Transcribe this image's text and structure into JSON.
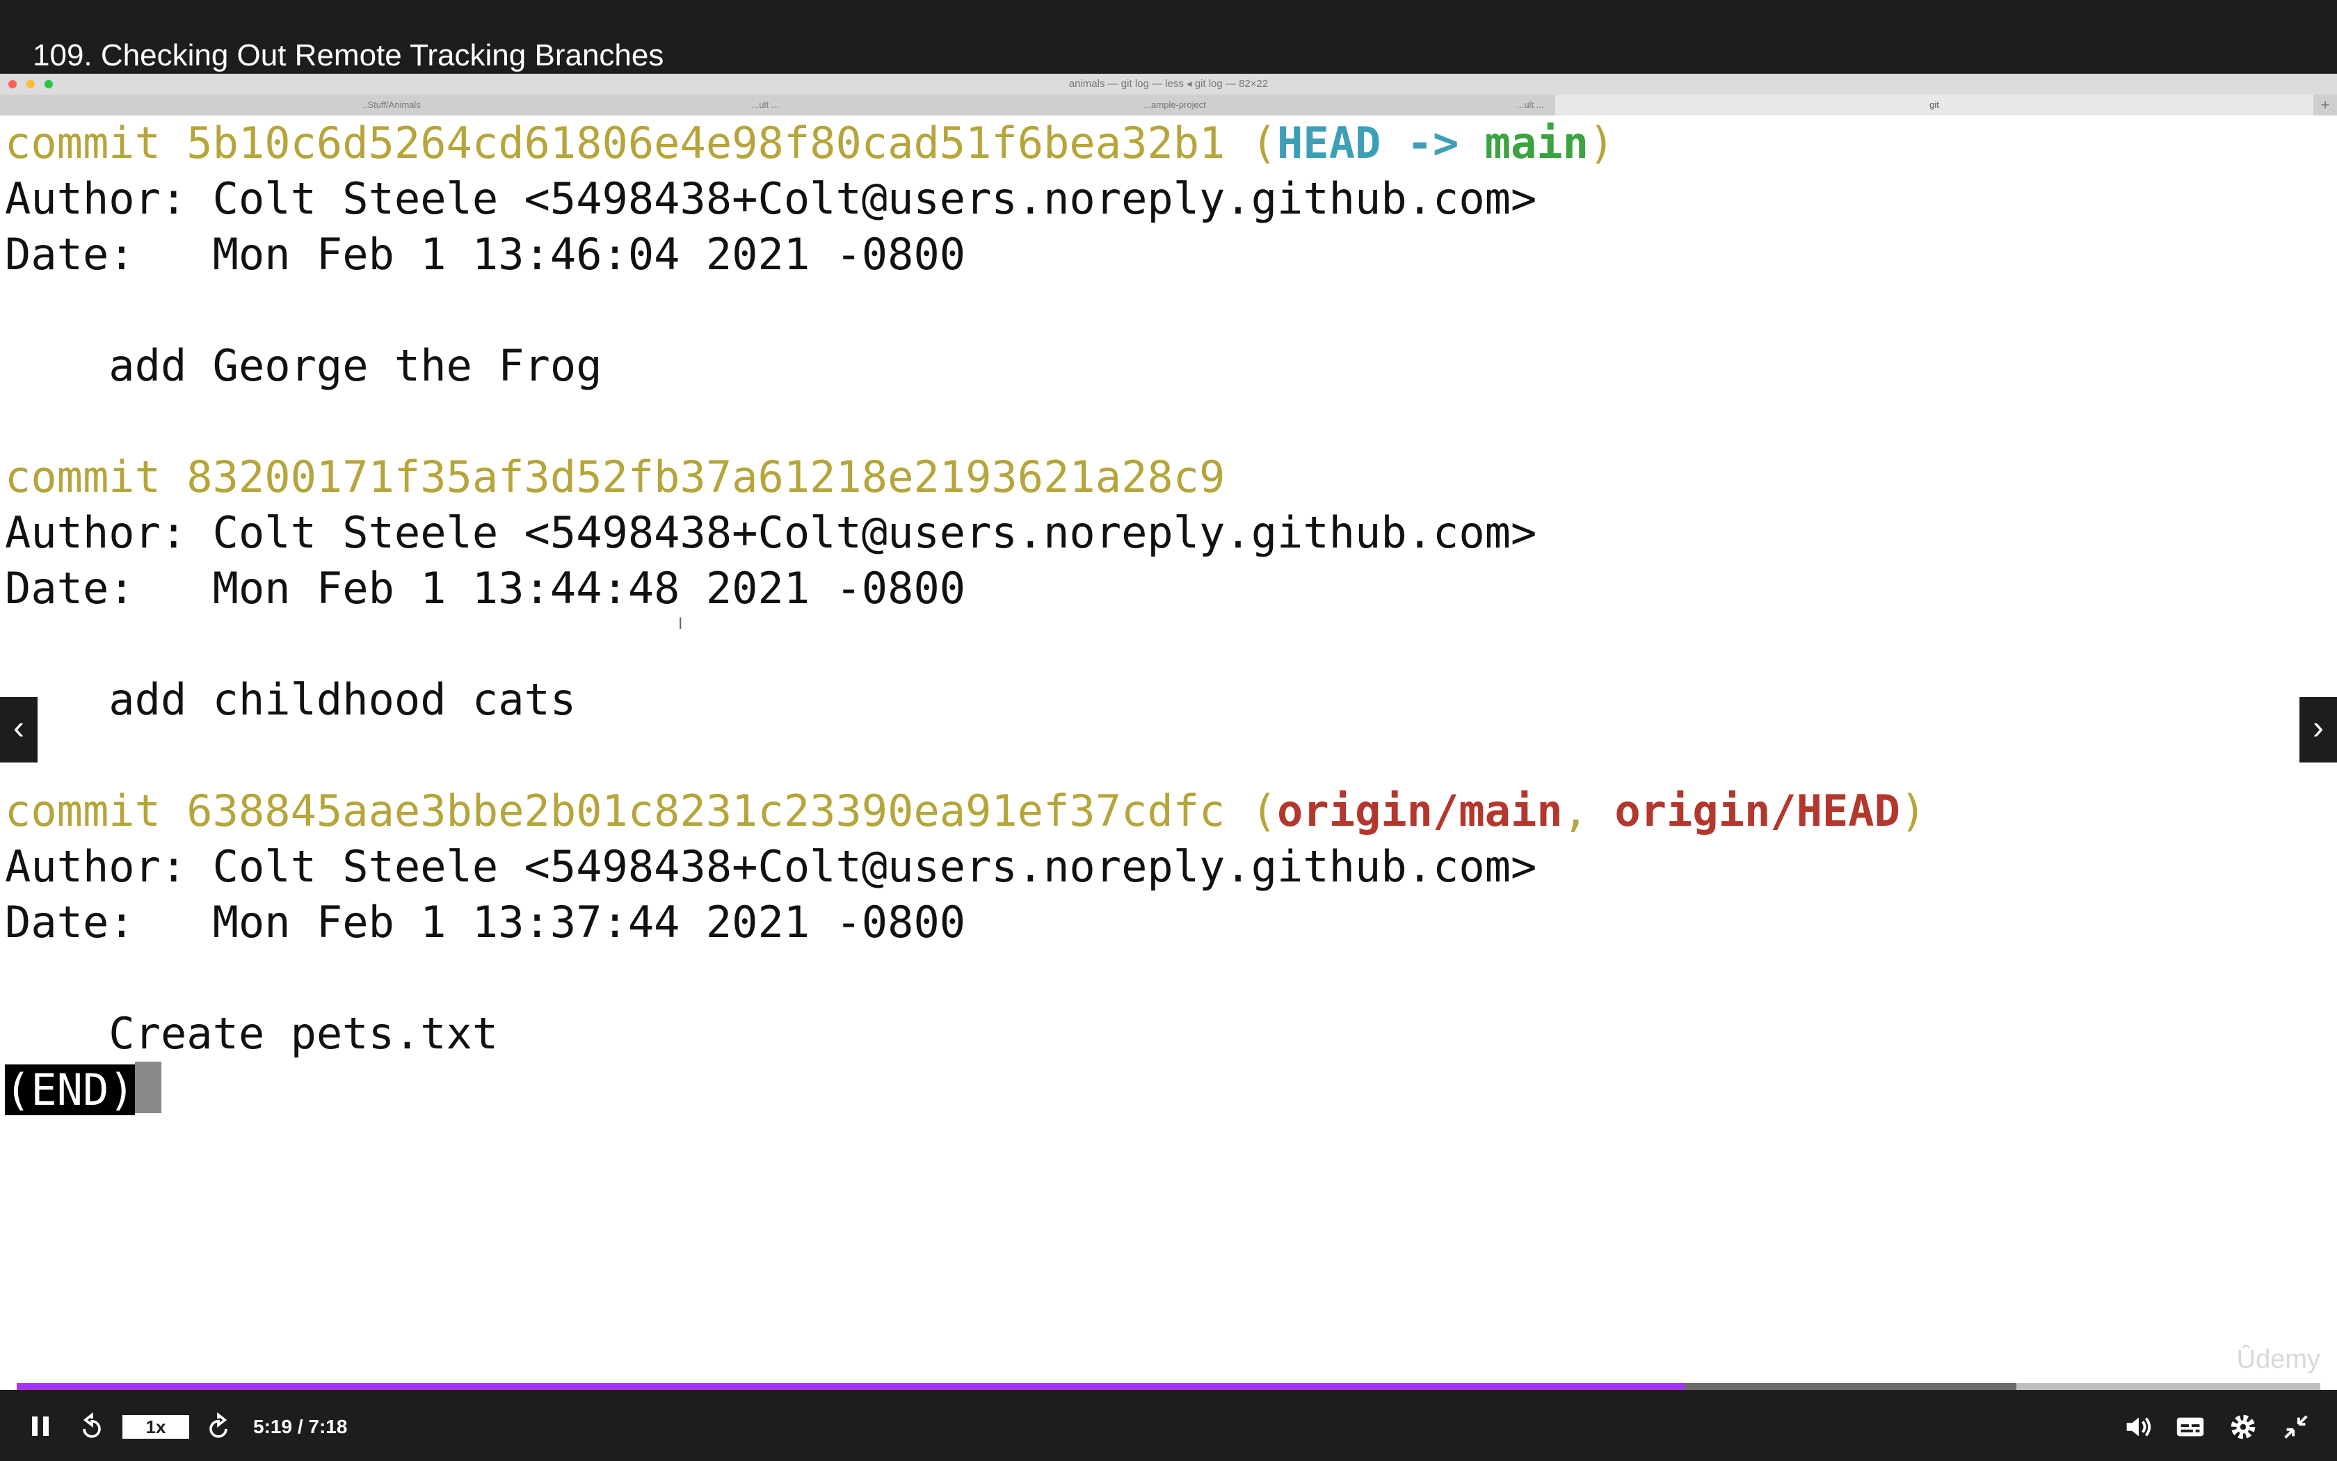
{
  "lecture": {
    "title": "109. Checking Out Remote Tracking Branches"
  },
  "terminal_window": {
    "title": "animals — git log — less ◂ git log — 82×22",
    "tabs": [
      "..Stuff/Animals",
      "...ult ...",
      "...ample-project",
      "...ult ...",
      "git"
    ]
  },
  "terminal": {
    "commits": [
      {
        "hash_line": "commit 5b10c6d5264cd61806e4e98f80cad51f6bea32b1",
        "refs_open": " (",
        "ref1": "HEAD -> ",
        "ref2": "main",
        "refs_close": ")",
        "author": "Author: Colt Steele <5498438+Colt@users.noreply.github.com>",
        "date": "Date:   Mon Feb 1 13:46:04 2021 -0800",
        "message": "    add George the Frog"
      },
      {
        "hash_line": "commit 83200171f35af3d52fb37a61218e2193621a28c9",
        "author": "Author: Colt Steele <5498438+Colt@users.noreply.github.com>",
        "date": "Date:   Mon Feb 1 13:44:48 2021 -0800",
        "message": "    add childhood cats"
      },
      {
        "hash_line": "commit 638845aae3bbe2b01c8231c23390ea91ef37cdfc",
        "refs_open": " (",
        "ref1": "origin/main",
        "ref_sep": ", ",
        "ref2": "origin/HEAD",
        "refs_close": ")",
        "author": "Author: Colt Steele <5498438+Colt@users.noreply.github.com>",
        "date": "Date:   Mon Feb 1 13:37:44 2021 -0800",
        "message": "    Create pets.txt"
      }
    ],
    "end_marker": "(END)",
    "ibeam": "I"
  },
  "player": {
    "speed": "1x",
    "time": "5:19 / 7:18",
    "played_fraction": 0.724,
    "buffered_fraction": 0.868,
    "prev_icon": "chevron-left-icon",
    "next_icon": "chevron-right-icon",
    "prev_glyph": "‹",
    "next_glyph": "›",
    "watermark": "Ûdemy"
  },
  "colors": {
    "accent": "#a435f0",
    "commit_hash": "#b5a53a",
    "head_ref": "#3c9fb5",
    "branch_ref": "#3ba340",
    "remote_ref": "#b3372c"
  }
}
